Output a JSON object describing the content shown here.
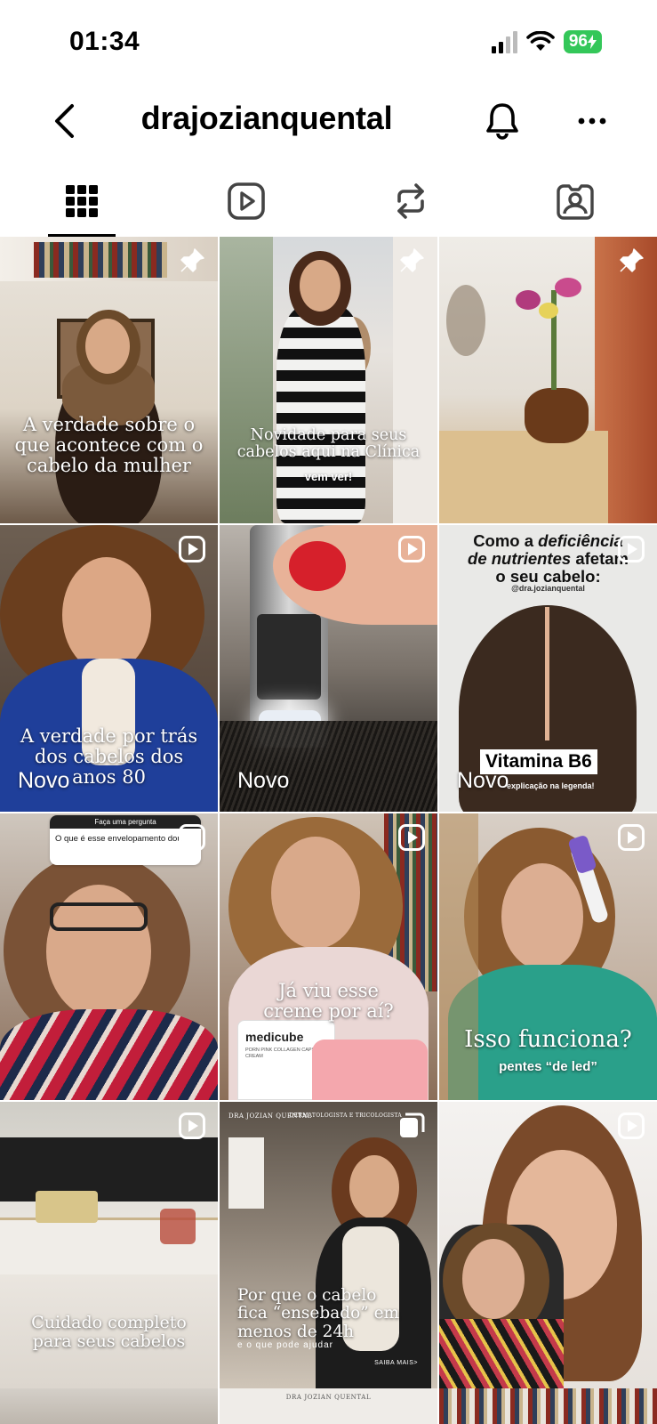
{
  "status": {
    "time": "01:34",
    "battery": "96"
  },
  "header": {
    "username": "drajozianquental"
  },
  "icons": {
    "back": "chevron-left-icon",
    "bell": "bell-icon",
    "more": "more-horizontal-icon",
    "grid": "grid-icon",
    "reels": "reels-icon",
    "reposts": "repost-icon",
    "tagged": "tagged-icon",
    "pin": "pin-icon",
    "reel": "reel-play-icon"
  },
  "posts": [
    {
      "caption": "A verdade sobre o que acontece com o cabelo da mulher",
      "badge": "pin"
    },
    {
      "caption": "Novidade para seus cabelos aqui na Clínica",
      "subcaption": "vem ver!",
      "badge": "pin"
    },
    {
      "caption": "",
      "badge": "pin"
    },
    {
      "caption": "A verdade por trás dos cabelos dos anos 80",
      "label": "Novo",
      "badge": "reel"
    },
    {
      "caption": "",
      "label": "Novo",
      "badge": "reel"
    },
    {
      "title_line1": "Como a",
      "title_em1": "deficiência",
      "title_em2": "de nutrientes",
      "title_line2": "afetam",
      "title_line3": "o seu cabelo:",
      "handle": "@dra.jozianquental",
      "tag": "Vitamina B6",
      "tag_sub": "explicação na legenda!",
      "label": "Novo",
      "badge": "reel"
    },
    {
      "question_title": "Faça uma pergunta",
      "question_text": "O que é esse envelopamento dou",
      "badge": "reel"
    },
    {
      "caption": "Já viu esse creme por aí?",
      "product": "medicube",
      "product_sub": "PORN PINK COLLAGEN CAPSULE CREAM",
      "badge": "reel"
    },
    {
      "caption": "Isso funciona?",
      "subcaption": "pentes “de led”",
      "badge": "reel"
    },
    {
      "caption": "Cuidado completo para seus cabelos",
      "badge": "reel"
    },
    {
      "top_left": "DRA JOZIAN QUENTAL",
      "top_right": "DERMATOLOGISTA E TRICOLOGISTA",
      "caption": "Por que o cabelo fica “ensebado” em menos de 24h",
      "subcaption": "e o que pode ajudar",
      "cta": "SAIBA MAIS>",
      "badge": "multi"
    },
    {
      "caption": "",
      "badge": "reel"
    }
  ],
  "bottom_row": {
    "middle_text": "DRA JOZIAN QUENTAL"
  }
}
